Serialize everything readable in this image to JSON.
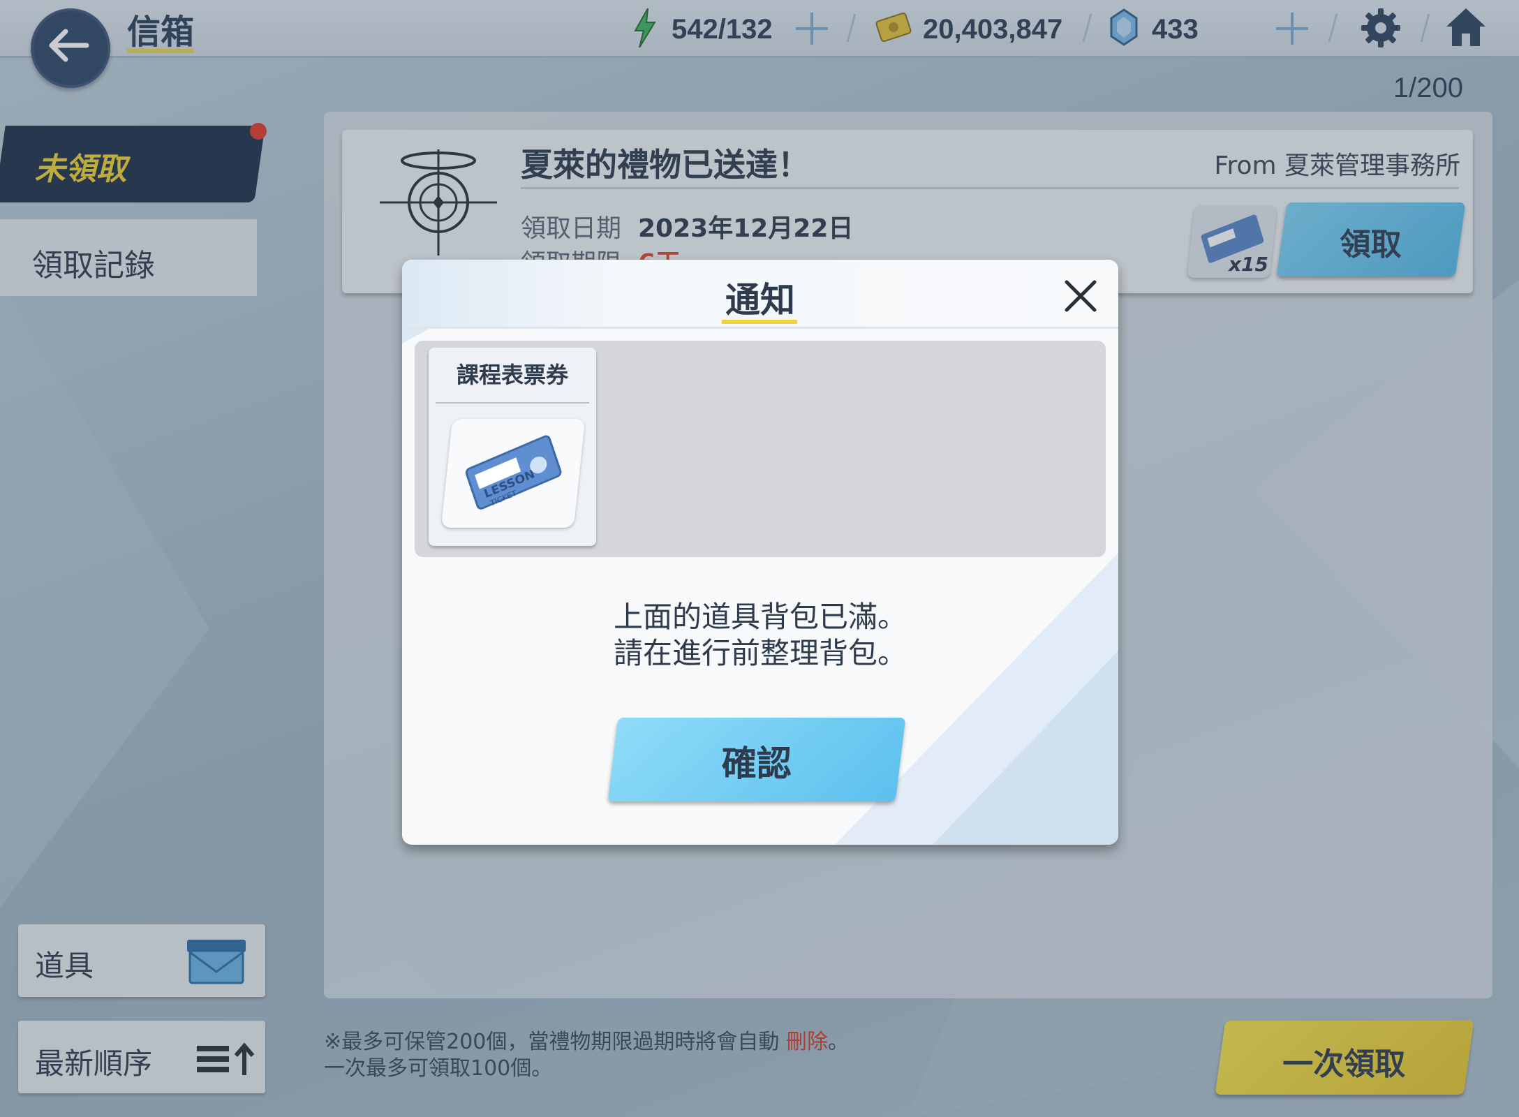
{
  "screen": {
    "title": "信箱",
    "page_count": "1/200"
  },
  "resources": {
    "ap": "542/132",
    "credits": "20,403,847",
    "gems": "433"
  },
  "sidebar": {
    "tabs": [
      {
        "label": "未領取"
      },
      {
        "label": "領取記錄"
      }
    ]
  },
  "mail": {
    "title": "夏萊的禮物已送達！",
    "from": "From 夏萊管理事務所",
    "date_label": "領取日期",
    "date": "2023年12月22日",
    "limit_label": "領取期限",
    "limit": "6天",
    "reward_count": "x15",
    "claim_label": "領取"
  },
  "bottom": {
    "item_filter": "道具",
    "sort": "最新順序",
    "note_line1": "※最多可保管200個，當禮物期限過期時將會自動",
    "note_delete": "刪除",
    "note_end": "。",
    "note_line2": "一次最多可領取100個。",
    "claim_all": "一次領取"
  },
  "modal": {
    "title": "通知",
    "item_name": "課程表票券",
    "ticket_text": "LESSON",
    "ticket_sub": "TICKET",
    "message_line1": "上面的道具背包已滿。",
    "message_line2": "請在進行前整理背包。",
    "confirm": "確認"
  },
  "colors": {
    "accent_yellow": "#e9d34a",
    "accent_blue": "#5cc0ee",
    "navy": "#1f3048",
    "alert_red": "#e0442f"
  }
}
